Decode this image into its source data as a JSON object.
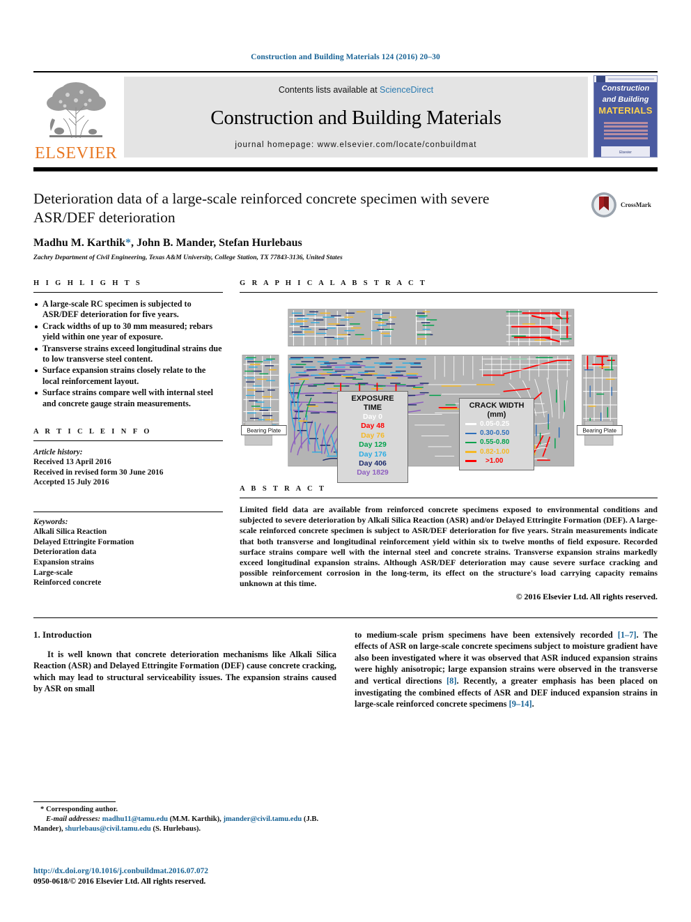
{
  "running_head": "Construction and Building Materials 124 (2016) 20–30",
  "masthead": {
    "publisher_logo_text": "ELSEVIER",
    "contents_prefix": "Contents lists available at ",
    "contents_link": "ScienceDirect",
    "journal_title": "Construction and Building Materials",
    "homepage_line": "journal homepage: www.elsevier.com/locate/conbuildmat",
    "cover": {
      "line1": "Construction",
      "line2": "and Building",
      "line3": "MATERIALS",
      "footer": "Elsevier"
    }
  },
  "article": {
    "title": "Deterioration data of a large-scale reinforced concrete specimen with severe ASR/DEF deterioration",
    "authors_pre": "Madhu M. Karthik",
    "authors_star": "*",
    "authors_post": ", John B. Mander, Stefan Hurlebaus",
    "affiliation": "Zachry Department of Civil Engineering, Texas A&M University, College Station, TX 77843-3136, United States",
    "crossmark_label": "CrossMark"
  },
  "highlights": {
    "heading": "H I G H L I G H T S",
    "items": [
      "A large-scale RC specimen is subjected to ASR/DEF deterioration for five years.",
      "Crack widths of up to 30 mm measured; rebars yield within one year of exposure.",
      "Transverse strains exceed longitudinal strains due to low transverse steel content.",
      "Surface expansion strains closely relate to the local reinforcement layout.",
      "Surface strains compare well with internal steel and concrete gauge strain measurements."
    ]
  },
  "article_info": {
    "heading": "A R T I C L E   I N F O",
    "history_label": "Article history:",
    "history": [
      "Received 13 April 2016",
      "Received in revised form 30 June 2016",
      "Accepted 15 July 2016"
    ],
    "keywords_label": "Keywords:",
    "keywords": [
      "Alkali Silica Reaction",
      "Delayed Ettringite Formation",
      "Deterioration data",
      "Expansion strains",
      "Large-scale",
      "Reinforced concrete"
    ]
  },
  "graphical_abstract": {
    "heading": "G R A P H I C A L   A B S T R A C T",
    "bearing_plate_left": "Bearing Plate",
    "bearing_plate_right": "Bearing Plate",
    "exposure_legend": {
      "title": "EXPOSURE TIME",
      "entries": [
        {
          "label": "Day 0",
          "color": "#ffffff"
        },
        {
          "label": "Day 48",
          "color": "#ff0000"
        },
        {
          "label": "Day 76",
          "color": "#f5b824"
        },
        {
          "label": "Day 129",
          "color": "#00a14b"
        },
        {
          "label": "Day 176",
          "color": "#29abe2"
        },
        {
          "label": "Day 406",
          "color": "#1b2a6b"
        },
        {
          "label": "Day 1829",
          "color": "#8e5fc0"
        }
      ]
    },
    "crack_legend": {
      "title": "CRACK WIDTH",
      "unit": "(mm)",
      "entries": [
        {
          "label": "0.05-0.25",
          "color": "#ffffff"
        },
        {
          "label": "0.30-0.50",
          "color": "#2f6fba"
        },
        {
          "label": "0.55-0.80",
          "color": "#00a14b"
        },
        {
          "label": "0.82-1.00",
          "color": "#f5b824"
        },
        {
          "label": ">1.00",
          "color": "#ff0000"
        }
      ]
    }
  },
  "abstract": {
    "heading": "A B S T R A C T",
    "body": "Limited field data are available from reinforced concrete specimens exposed to environmental conditions and subjected to severe deterioration by Alkali Silica Reaction (ASR) and/or Delayed Ettringite Formation (DEF). A large-scale reinforced concrete specimen is subject to ASR/DEF deterioration for five years. Strain measurements indicate that both transverse and longitudinal reinforcement yield within six to twelve months of field exposure. Recorded surface strains compare well with the internal steel and concrete strains. Transverse expansion strains markedly exceed longitudinal expansion strains. Although ASR/DEF deterioration may cause severe surface cracking and possible reinforcement corrosion in the long-term, its effect on the structure's load carrying capacity remains unknown at this time.",
    "copyright": "© 2016 Elsevier Ltd. All rights reserved."
  },
  "introduction": {
    "heading": "1. Introduction",
    "col1_para": "It is well known that concrete deterioration mechanisms like Alkali Silica Reaction (ASR) and Delayed Ettringite Formation (DEF) cause concrete cracking, which may lead to structural serviceability issues. The expansion strains caused by ASR on small",
    "col2_segments": [
      {
        "text": "to medium-scale prism specimens have been extensively recorded ",
        "link": false
      },
      {
        "text": "[1–7]",
        "link": true
      },
      {
        "text": ". The effects of ASR on large-scale concrete specimens subject to moisture gradient have also been investigated where it was observed that ASR induced expansion strains were highly anisotropic; large expansion strains were observed in the transverse and vertical directions ",
        "link": false
      },
      {
        "text": "[8]",
        "link": true
      },
      {
        "text": ". Recently, a greater emphasis has been placed on investigating the combined effects of ASR and DEF induced expansion strains in large-scale reinforced concrete specimens ",
        "link": false
      },
      {
        "text": "[9–14]",
        "link": true
      },
      {
        "text": ".",
        "link": false
      }
    ]
  },
  "footnote": {
    "corresponding": "* Corresponding author.",
    "email_label": "E-mail addresses:",
    "email1": "madhu11@tamu.edu",
    "email1_who": " (M.M. Karthik), ",
    "email2": "jmander@civil.tamu.edu",
    "email2_who": " (J.B. Mander), ",
    "email3": "shurlebaus@civil.tamu.edu",
    "email3_who": " (S. Hurlebaus)."
  },
  "doi": {
    "url": "http://dx.doi.org/10.1016/j.conbuildmat.2016.07.072",
    "issn_line": "0950-0618/© 2016 Elsevier Ltd. All rights reserved."
  }
}
